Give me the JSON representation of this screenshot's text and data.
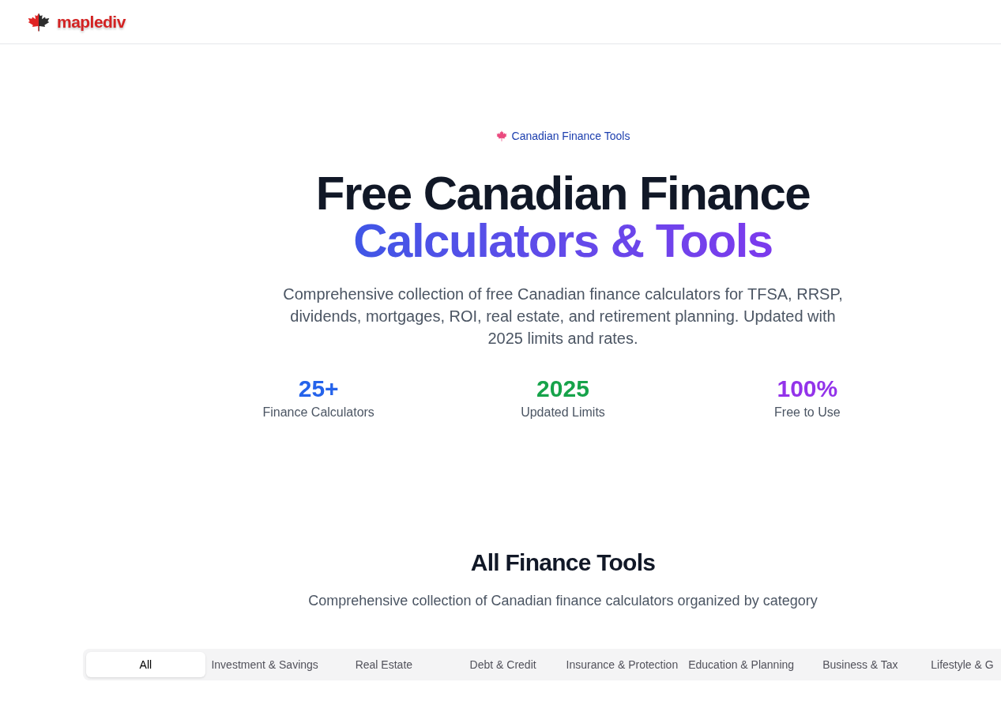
{
  "header": {
    "logo_text": "maplediv"
  },
  "hero": {
    "badge": "Canadian Finance Tools",
    "title_line_1": "Free Canadian Finance",
    "title_line_2": "Calculators & Tools",
    "description": "Comprehensive collection of free Canadian finance calculators for TFSA, RRSP, dividends, mortgages, ROI, real estate, and retirement planning. Updated with 2025 limits and rates.",
    "stats": [
      {
        "value": "25+",
        "label": "Finance Calculators",
        "color": "#2563eb"
      },
      {
        "value": "2025",
        "label": "Updated Limits",
        "color": "#16a34a"
      },
      {
        "value": "100%",
        "label": "Free to Use",
        "color": "#9333ea"
      }
    ]
  },
  "tools_section": {
    "title": "All Finance Tools",
    "subtitle": "Comprehensive collection of Canadian finance calculators organized by category",
    "tabs": [
      {
        "label": "All",
        "selected": true
      },
      {
        "label": "Investment & Savings",
        "selected": false
      },
      {
        "label": "Real Estate",
        "selected": false
      },
      {
        "label": "Debt & Credit",
        "selected": false
      },
      {
        "label": "Insurance & Protection",
        "selected": false
      },
      {
        "label": "Education & Planning",
        "selected": false
      },
      {
        "label": "Business & Tax",
        "selected": false
      },
      {
        "label": "Lifestyle & G",
        "selected": false
      }
    ]
  }
}
